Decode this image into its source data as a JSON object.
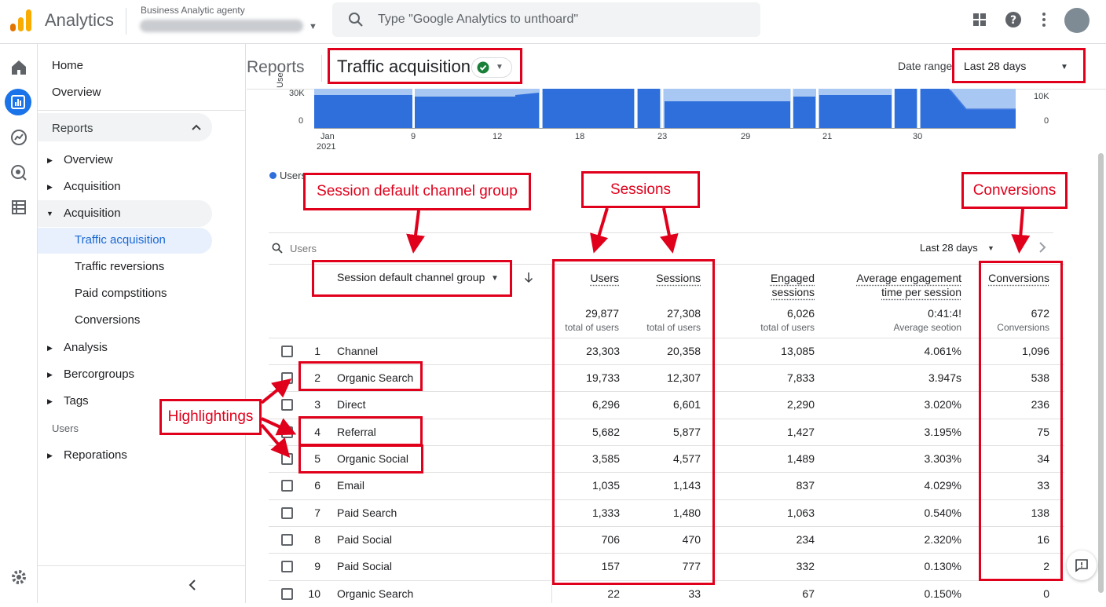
{
  "topbar": {
    "app_title": "Analytics",
    "account_label": "Business Analytic agenty",
    "search_placeholder": "Type \"Google Analytics to unthoard\""
  },
  "nav": {
    "home": "Home",
    "overview": "Overview",
    "reports": "Reports",
    "items": [
      "Overview",
      "Acquisition",
      "Acquisition"
    ],
    "sub_items": [
      "Traffic acquisition",
      "Traffic reversions",
      "Paid compstitions",
      "Conversions"
    ],
    "more_items": [
      "Analysis",
      "Bercorgroups",
      "Tags"
    ],
    "users_label": "Users",
    "last_item": "Reporations"
  },
  "header": {
    "reports": "Reports",
    "page_title": "Traffic acquisition",
    "date_range_label": "Date range",
    "date_range_value": "Last 28 days"
  },
  "chart": {
    "y_left_ticks": [
      "30K",
      "0"
    ],
    "y_left_label": "Use",
    "y_right_ticks": [
      "10K",
      "0"
    ],
    "x_ticks": [
      "Jan",
      "9",
      "12",
      "18",
      "23",
      "29",
      "21",
      "30"
    ],
    "x_year": "2021",
    "legend": "Users",
    "colors": {
      "dark": "#2f6fdc",
      "light": "#a8c7f2"
    }
  },
  "annotations": {
    "channel_group": "Session default channel group",
    "sessions": "Sessions",
    "conversions": "Conversions",
    "highlightings": "Highlightings"
  },
  "table": {
    "search_placeholder": "Users",
    "range": "Last 28 days",
    "dimension_header": "Session default channel group",
    "headers": {
      "users": "Users",
      "sessions": "Sessions",
      "engaged_1": "Engaged",
      "engaged_2": "sessions",
      "avg_1": "Average engagement",
      "avg_2": "time per session",
      "conversions": "Conversions"
    },
    "totals": {
      "users": "29,877",
      "users_sub": "total of users",
      "sessions": "27,308",
      "sessions_sub": "total of users",
      "engaged": "6,026",
      "engaged_sub": "total of users",
      "avg": "0:41:4!",
      "avg_sub": "Average seotion",
      "conversions": "672",
      "conversions_sub": "Conversions"
    },
    "rows": [
      {
        "idx": "1",
        "channel": "Channel",
        "users": "23,303",
        "sessions": "20,358",
        "engaged": "13,085",
        "avg": "4.061%",
        "conv": "1,096"
      },
      {
        "idx": "2",
        "channel": "Organic Search",
        "users": "19,733",
        "sessions": "12,307",
        "engaged": "7,833",
        "avg": "3.947s",
        "conv": "538"
      },
      {
        "idx": "3",
        "channel": "Direct",
        "users": "6,296",
        "sessions": "6,601",
        "engaged": "2,290",
        "avg": "3.020%",
        "conv": "236"
      },
      {
        "idx": "4",
        "channel": "Referral",
        "users": "5,682",
        "sessions": "5,877",
        "engaged": "1,427",
        "avg": "3.195%",
        "conv": "75"
      },
      {
        "idx": "5",
        "channel": "Organic Social",
        "users": "3,585",
        "sessions": "4,577",
        "engaged": "1,489",
        "avg": "3.303%",
        "conv": "34"
      },
      {
        "idx": "6",
        "channel": "Email",
        "users": "1,035",
        "sessions": "1,143",
        "engaged": "837",
        "avg": "4.029%",
        "conv": "33"
      },
      {
        "idx": "7",
        "channel": "Paid Search",
        "users": "1,333",
        "sessions": "1,480",
        "engaged": "1,063",
        "avg": "0.540%",
        "conv": "138"
      },
      {
        "idx": "8",
        "channel": "Paid Social",
        "users": "706",
        "sessions": "470",
        "engaged": "234",
        "avg": "2.320%",
        "conv": "16"
      },
      {
        "idx": "9",
        "channel": "Paid Social",
        "users": "157",
        "sessions": "777",
        "engaged": "332",
        "avg": "0.130%",
        "conv": "2"
      },
      {
        "idx": "10",
        "channel": "Organic Search",
        "users": "22",
        "sessions": "33",
        "engaged": "67",
        "avg": "0.150%",
        "conv": "0"
      }
    ]
  }
}
